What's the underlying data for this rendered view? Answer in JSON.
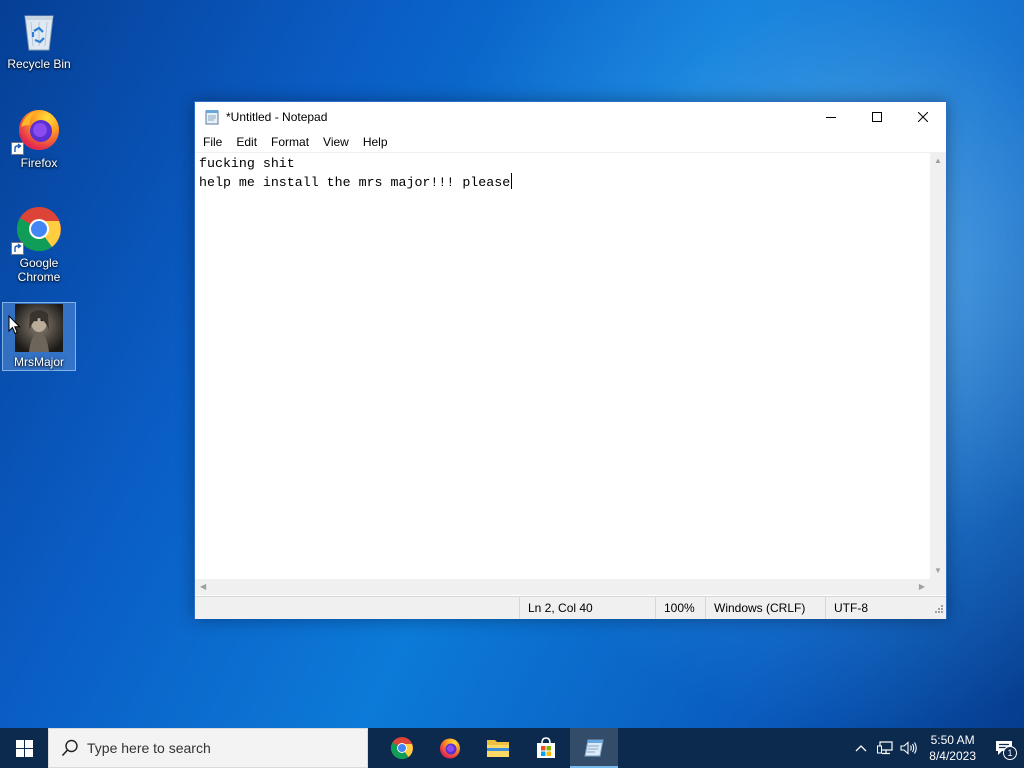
{
  "desktop": {
    "icons": [
      {
        "label": "Recycle Bin",
        "icon": "recycle-bin-icon"
      },
      {
        "label": "Firefox",
        "icon": "firefox-icon"
      },
      {
        "label": "Google Chrome",
        "icon": "chrome-icon"
      },
      {
        "label": "MrsMajor",
        "icon": "mrsmajor-image-icon",
        "selected": true
      }
    ]
  },
  "notepad": {
    "title": "*Untitled - Notepad",
    "menu": [
      "File",
      "Edit",
      "Format",
      "View",
      "Help"
    ],
    "lines": [
      "fucking shit",
      "help me install the mrs major!!! please"
    ],
    "status": {
      "position": "Ln 2, Col 40",
      "zoom": "100%",
      "line_ending": "Windows (CRLF)",
      "encoding": "UTF-8"
    }
  },
  "taskbar": {
    "search_placeholder": "Type here to search",
    "apps": [
      "chrome-icon",
      "firefox-icon",
      "file-explorer-icon",
      "microsoft-store-icon",
      "notepad-icon"
    ],
    "active_app": "notepad-icon",
    "clock": {
      "time": "5:50 AM",
      "date": "8/4/2023"
    },
    "notification_count": "1"
  },
  "colors": {
    "taskbar": "#0c2a4e",
    "window_border": "#2d6ec7",
    "active_indicator": "#76b9ed"
  }
}
